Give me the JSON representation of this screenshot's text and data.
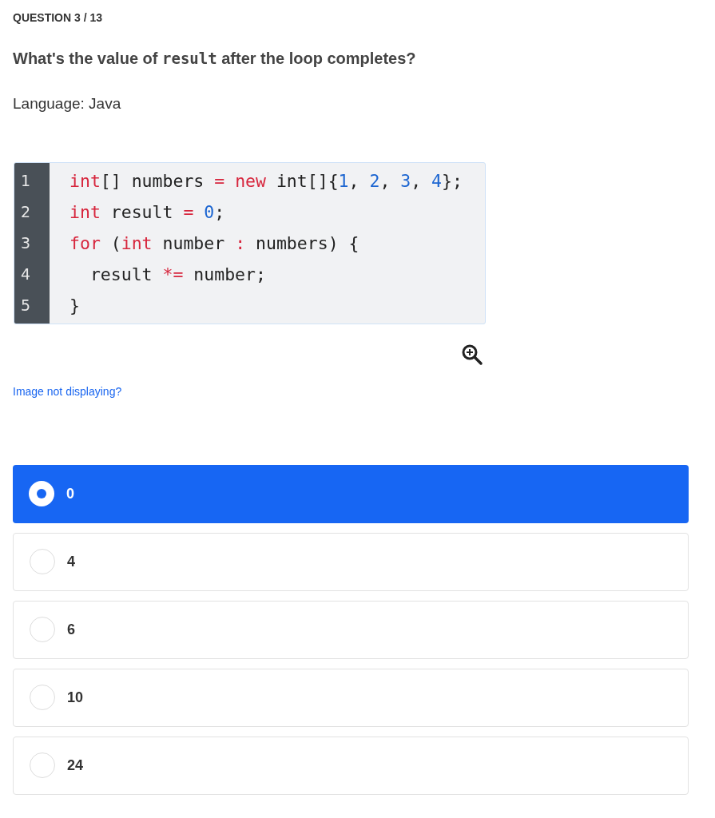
{
  "progress": "QUESTION 3 / 13",
  "question": [
    {
      "kind": "text",
      "text": "What's the value of "
    },
    {
      "kind": "code",
      "text": "result"
    },
    {
      "kind": "text",
      "text": " after the loop completes?"
    }
  ],
  "language": "Language: Java",
  "code": {
    "lines": [
      {
        "number": "1",
        "tokens": [
          {
            "kind": "kw",
            "text": "int"
          },
          {
            "kind": "plain",
            "text": "[] numbers "
          },
          {
            "kind": "op",
            "text": "= "
          },
          {
            "kind": "kw",
            "text": "new"
          },
          {
            "kind": "plain",
            "text": " int[]{"
          },
          {
            "kind": "num",
            "text": "1"
          },
          {
            "kind": "plain",
            "text": ", "
          },
          {
            "kind": "num",
            "text": "2"
          },
          {
            "kind": "plain",
            "text": ", "
          },
          {
            "kind": "num",
            "text": "3"
          },
          {
            "kind": "plain",
            "text": ", "
          },
          {
            "kind": "num",
            "text": "4"
          },
          {
            "kind": "plain",
            "text": "};"
          }
        ]
      },
      {
        "number": "2",
        "tokens": [
          {
            "kind": "kw",
            "text": "int"
          },
          {
            "kind": "plain",
            "text": " result "
          },
          {
            "kind": "op",
            "text": "= "
          },
          {
            "kind": "num",
            "text": "0"
          },
          {
            "kind": "plain",
            "text": ";"
          }
        ]
      },
      {
        "number": "3",
        "tokens": [
          {
            "kind": "kw",
            "text": "for"
          },
          {
            "kind": "plain",
            "text": " ("
          },
          {
            "kind": "kw",
            "text": "int"
          },
          {
            "kind": "plain",
            "text": " number "
          },
          {
            "kind": "op",
            "text": ":"
          },
          {
            "kind": "plain",
            "text": " numbers) {"
          }
        ]
      },
      {
        "number": "4",
        "tokens": [
          {
            "kind": "plain",
            "text": "  result "
          },
          {
            "kind": "op",
            "text": "*="
          },
          {
            "kind": "plain",
            "text": " number;"
          }
        ]
      },
      {
        "number": "5",
        "tokens": [
          {
            "kind": "plain",
            "text": "}"
          }
        ]
      }
    ]
  },
  "help_link": "Image not displaying?",
  "options": [
    {
      "label": "0",
      "selected": true
    },
    {
      "label": "4",
      "selected": false
    },
    {
      "label": "6",
      "selected": false
    },
    {
      "label": "10",
      "selected": false
    },
    {
      "label": "24",
      "selected": false
    }
  ]
}
